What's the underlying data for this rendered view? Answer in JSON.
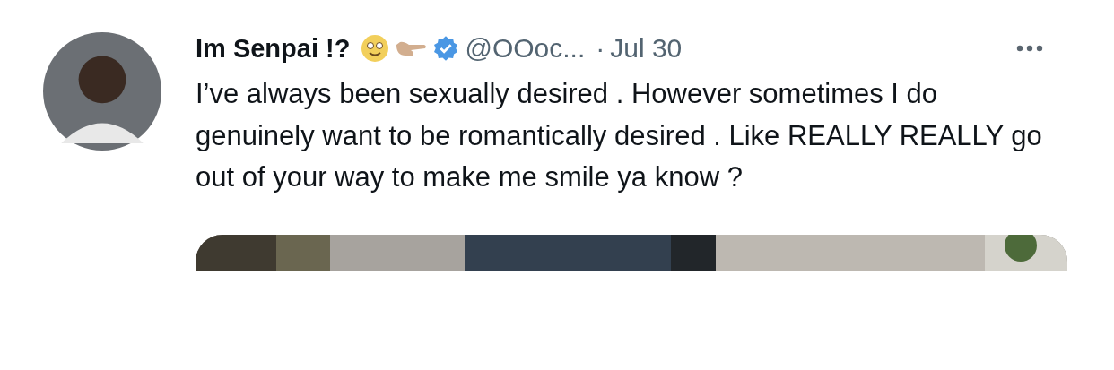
{
  "post": {
    "author": {
      "name": "Im Senpai !?",
      "verified": true,
      "handle": "@OOoc...",
      "separator": "·",
      "date": "Jul 30"
    },
    "text": "I’ve always been sexually desired . However sometimes I do genuinely want to be romantically desired . Like REALLY REALLY go out of your way to make me smile ya know ?"
  }
}
